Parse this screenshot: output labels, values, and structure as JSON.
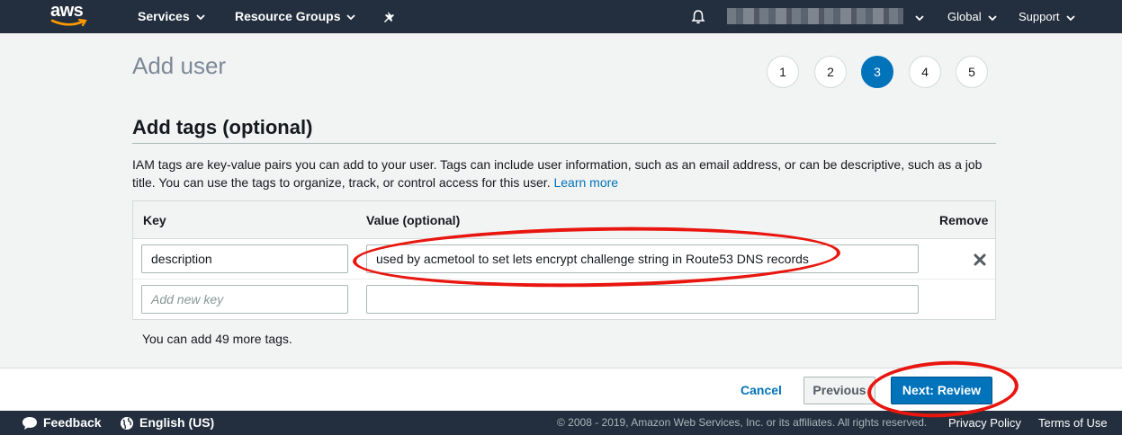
{
  "nav": {
    "logo_text": "aws",
    "services": "Services",
    "resource_groups": "Resource Groups",
    "region": "Global",
    "support": "Support"
  },
  "page": {
    "title": "Add user",
    "steps": [
      "1",
      "2",
      "3",
      "4",
      "5"
    ],
    "active_step": "3"
  },
  "section": {
    "title": "Add tags (optional)",
    "description": "IAM tags are key-value pairs you can add to your user. Tags can include user information, such as an email address, or can be descriptive, such as a job title. You can use the tags to organize, track, or control access for this user.",
    "learn_more": "Learn more"
  },
  "table": {
    "col_key": "Key",
    "col_value": "Value (optional)",
    "col_remove": "Remove",
    "rows": [
      {
        "key": "description",
        "value": "used by acmetool to set lets encrypt challenge string in Route53 DNS records"
      }
    ],
    "new_key_placeholder": "Add new key",
    "new_value_placeholder": ""
  },
  "remaining": "You can add 49 more tags.",
  "buttons": {
    "cancel": "Cancel",
    "previous": "Previous",
    "next": "Next: Review"
  },
  "footer": {
    "feedback": "Feedback",
    "language": "English (US)",
    "copyright": "© 2008 - 2019, Amazon Web Services, Inc. or its affiliates. All rights reserved.",
    "privacy": "Privacy Policy",
    "terms": "Terms of Use"
  },
  "colors": {
    "nav_bg": "#232f3e",
    "primary": "#0073bb",
    "annotation": "#e8160f"
  }
}
